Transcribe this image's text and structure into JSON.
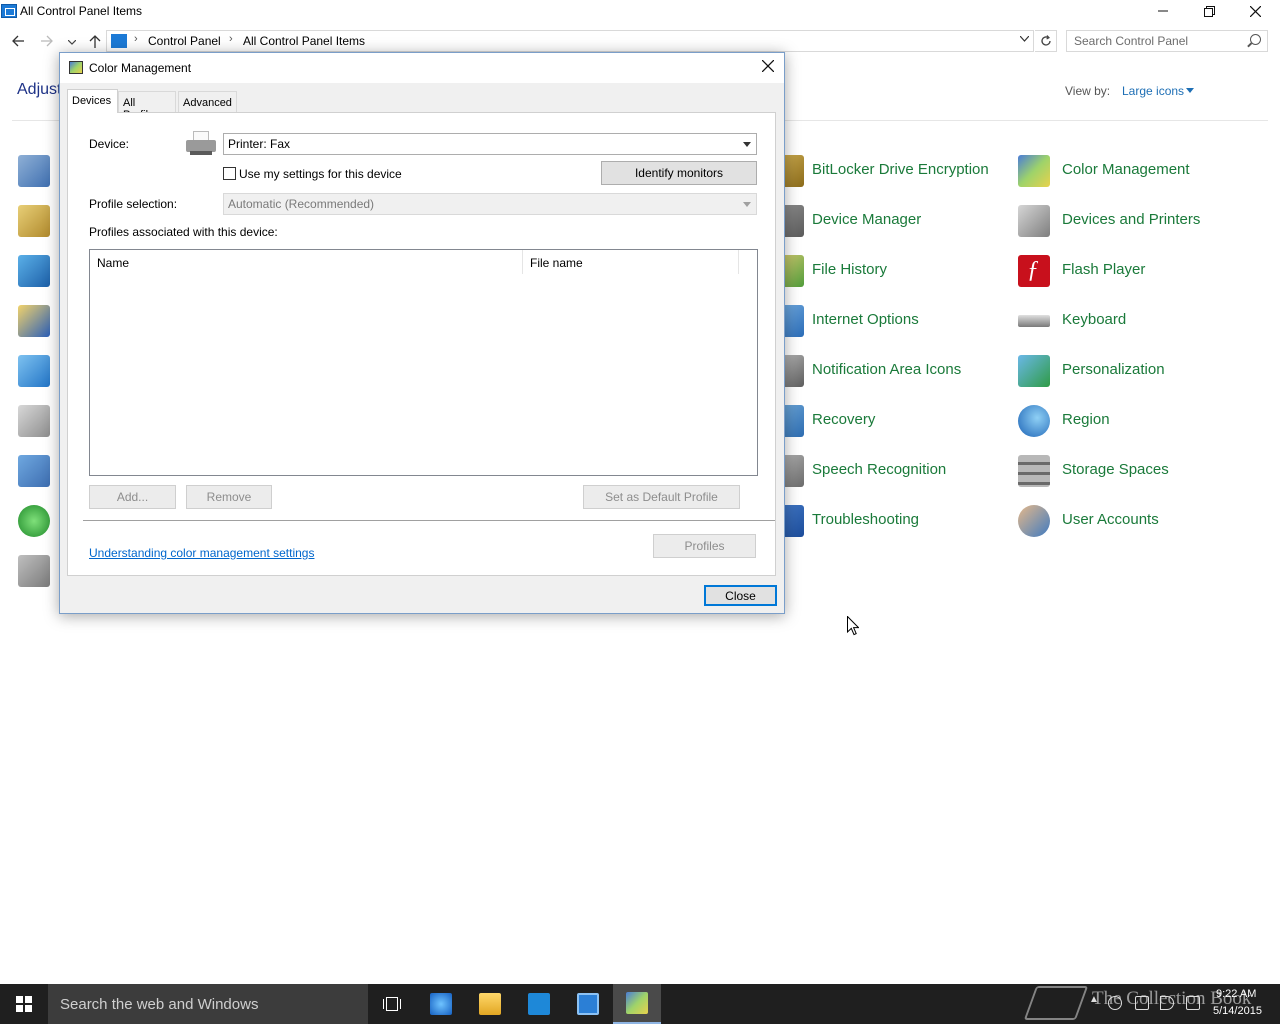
{
  "window": {
    "title": "All Control Panel Items",
    "breadcrumbs": [
      "Control Panel",
      "All Control Panel Items"
    ],
    "search_placeholder": "Search Control Panel",
    "heading": "Adjust",
    "view_by_label": "View by:",
    "view_by_value": "Large icons"
  },
  "control_panel_items": [
    {
      "label": "BitLocker Drive Encryption",
      "icon": "bitlocker-icon"
    },
    {
      "label": "Color Management",
      "icon": "color-management-icon"
    },
    {
      "label": "Device Manager",
      "icon": "device-manager-icon"
    },
    {
      "label": "Devices and Printers",
      "icon": "devices-printers-icon"
    },
    {
      "label": "File History",
      "icon": "file-history-icon"
    },
    {
      "label": "Flash Player",
      "icon": "flash-player-icon"
    },
    {
      "label": "Internet Options",
      "icon": "internet-options-icon"
    },
    {
      "label": "Keyboard",
      "icon": "keyboard-icon"
    },
    {
      "label": "Notification Area Icons",
      "icon": "notification-area-icon"
    },
    {
      "label": "Personalization",
      "icon": "personalization-icon"
    },
    {
      "label": "Recovery",
      "icon": "recovery-icon"
    },
    {
      "label": "Region",
      "icon": "region-icon"
    },
    {
      "label": "Speech Recognition",
      "icon": "speech-recognition-icon"
    },
    {
      "label": "Storage Spaces",
      "icon": "storage-spaces-icon"
    },
    {
      "label": "Troubleshooting",
      "icon": "troubleshooting-icon"
    },
    {
      "label": "User Accounts",
      "icon": "user-accounts-icon"
    }
  ],
  "dialog": {
    "title": "Color Management",
    "tabs": [
      "Devices",
      "All Profiles",
      "Advanced"
    ],
    "active_tab": "Devices",
    "device_label": "Device:",
    "device_value": "Printer: Fax",
    "use_my_settings_label": "Use my settings for this device",
    "use_my_settings_checked": false,
    "identify_monitors_label": "Identify monitors",
    "profile_selection_label": "Profile selection:",
    "profile_selection_value": "Automatic (Recommended)",
    "profiles_associated_label": "Profiles associated with this device:",
    "columns": [
      "Name",
      "File name"
    ],
    "rows": [],
    "add_label": "Add...",
    "remove_label": "Remove",
    "set_default_label": "Set as Default Profile",
    "help_link": "Understanding color management settings",
    "profiles_button": "Profiles",
    "close_button": "Close"
  },
  "taskbar": {
    "search_placeholder": "Search the web and Windows",
    "watermark": "The Collection Book",
    "time": "9:22 AM",
    "date": "5/14/2015"
  },
  "colors": {
    "link_green": "#1a7a3a",
    "link_blue": "#0066cc",
    "heading_blue": "#1e3287",
    "taskbar": "#1f1f1f",
    "accent": "#0078d7"
  }
}
